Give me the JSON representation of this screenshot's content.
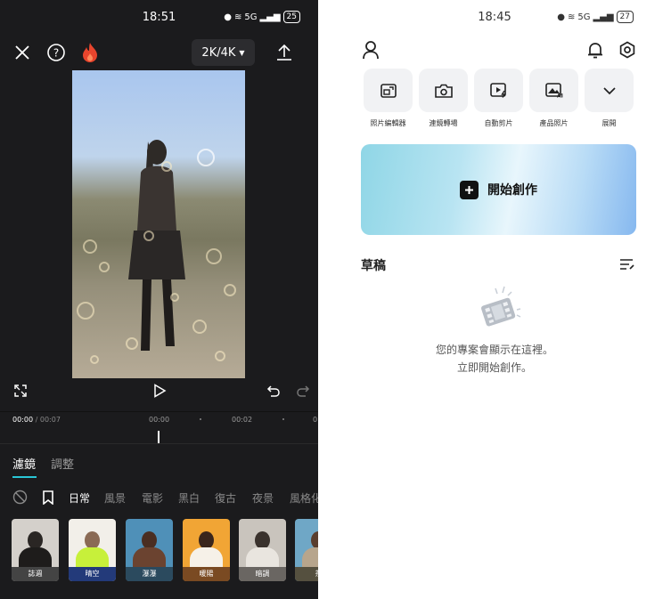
{
  "left": {
    "status": {
      "time": "18:51",
      "network": "5G",
      "battery": "25"
    },
    "topbar": {
      "resolution": "2K/4K"
    },
    "timeline": {
      "current": "00:00",
      "total": "/ 00:07",
      "ticks": [
        "00:00",
        "00:02",
        "0"
      ]
    },
    "tabs": {
      "filter": "濾鏡",
      "adjust": "調整"
    },
    "categories": [
      "日常",
      "風景",
      "電影",
      "黑白",
      "復古",
      "夜景",
      "風格化"
    ],
    "filters": [
      {
        "name": "誌週",
        "bg": "#d4d0cb",
        "label_bg": "#444444"
      },
      {
        "name": "晴空",
        "bg": "#f2efe9",
        "label_bg": "#233a7a"
      },
      {
        "name": "瀑瀑",
        "bg": "#4f90b8",
        "label_bg": "#2b4a5e"
      },
      {
        "name": "暖陽",
        "bg": "#f1a535",
        "label_bg": "#7a4a22"
      },
      {
        "name": "暗調",
        "bg": "#c9c4bd",
        "label_bg": "#6a6662"
      },
      {
        "name": "茶",
        "bg": "#6fa7c6",
        "label_bg": "#55503f"
      }
    ],
    "colors": {
      "accent": "#29c6d6",
      "fire": "#e8452d"
    }
  },
  "right": {
    "status": {
      "time": "18:45",
      "network": "5G",
      "battery": "27"
    },
    "tools": [
      {
        "label": "照片編輯器",
        "icon": "photo-editor-icon"
      },
      {
        "label": "連鏡轉場",
        "icon": "camera-transition-icon"
      },
      {
        "label": "自動剪片",
        "icon": "auto-cut-icon"
      },
      {
        "label": "產品照片",
        "icon": "product-photo-ai-icon"
      },
      {
        "label": "展開",
        "icon": "chevron-down-icon"
      }
    ],
    "create_label": "開始創作",
    "drafts_title": "草稿",
    "empty_line1": "您的專案會顯示在這裡。",
    "empty_line2": "立即開始創作。"
  }
}
